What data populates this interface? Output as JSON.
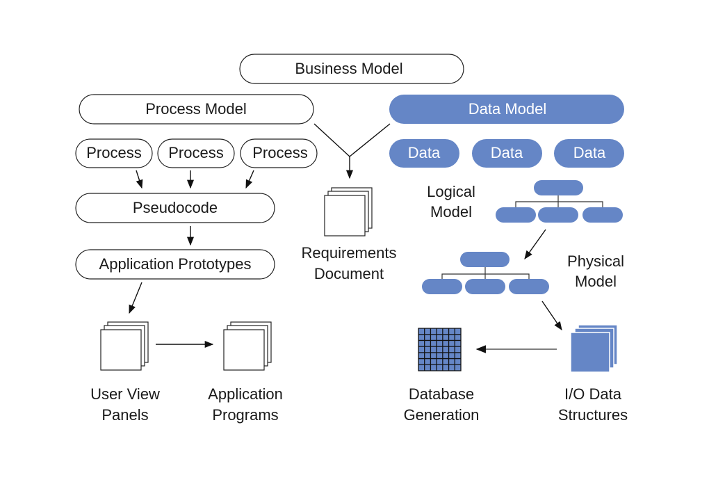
{
  "diagram": {
    "business_model": "Business Model",
    "process_model": "Process Model",
    "data_model": "Data Model",
    "processes": [
      "Process",
      "Process",
      "Process"
    ],
    "data_items": [
      "Data",
      "Data",
      "Data"
    ],
    "pseudocode": "Pseudocode",
    "application_prototypes": "Application Prototypes",
    "requirements_document": [
      "Requirements",
      "Document"
    ],
    "logical_model": [
      "Logical",
      "Model"
    ],
    "physical_model": [
      "Physical",
      "Model"
    ],
    "user_view_panels": [
      "User View",
      "Panels"
    ],
    "application_programs": [
      "Application",
      "Programs"
    ],
    "database_generation": [
      "Database",
      "Generation"
    ],
    "io_data_structures": [
      "I/O Data",
      "Structures"
    ]
  },
  "colors": {
    "accent": "#6586c6",
    "outline": "#222222",
    "text": "#1a1a1a"
  }
}
